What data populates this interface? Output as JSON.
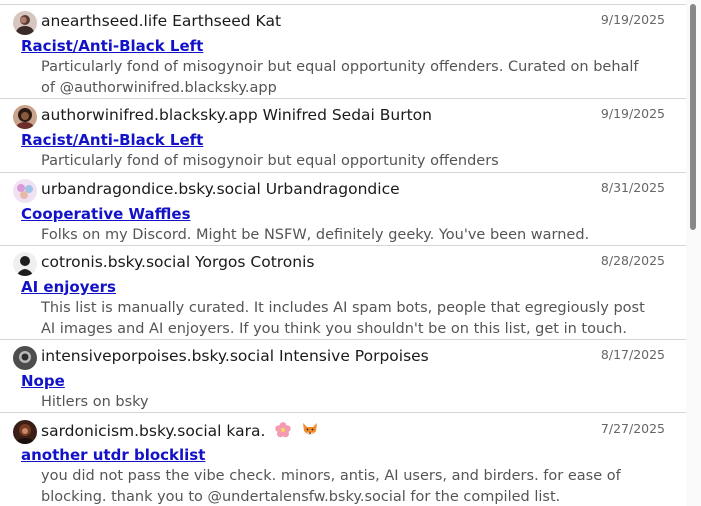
{
  "items": [
    {
      "author": "anearthseed.life Earthseed Kat",
      "date": "9/19/2025",
      "title": "Racist/Anti-Black Left",
      "description": "Particularly fond of misogynoir but equal opportunity offenders. Curated on behalf of @authorwinifred.blacksky.app"
    },
    {
      "author": "authorwinifred.blacksky.app Winifred Sedai Burton",
      "date": "9/19/2025",
      "title": "Racist/Anti-Black Left",
      "description": "Particularly fond of misogynoir but equal opportunity offenders"
    },
    {
      "author": "urbandragondice.bsky.social Urbandragondice",
      "date": "8/31/2025",
      "title": "Cooperative Waffles",
      "description": "Folks on my Discord. Might be NSFW, definitely geeky. You've been warned."
    },
    {
      "author": "cotronis.bsky.social Yorgos Cotronis",
      "date": "8/28/2025",
      "title": "AI enjoyers",
      "description": "This list is manually curated. It includes AI spam bots, people that egregiously post AI images and AI enjoyers. If you think you shouldn't be on this list, get in touch."
    },
    {
      "author": "intensiveporpoises.bsky.social Intensive Porpoises",
      "date": "8/17/2025",
      "title": "Nope",
      "description": "Hitlers on bsky"
    },
    {
      "author": "sardonicism.bsky.social kara.",
      "date": "7/27/2025",
      "title": "another utdr blocklist",
      "description": "you did not pass the vibe check. minors, antis, AI users, and birders. for ease of blocking. thank you to @undertalensfw.bsky.social for the compiled list."
    }
  ],
  "icons": {
    "flower": "cherry-blossom-icon",
    "fox": "fox-icon"
  },
  "colors": {
    "link": "#1212c8",
    "date": "#666666",
    "description": "#555555",
    "divider": "#d6d6d6"
  }
}
